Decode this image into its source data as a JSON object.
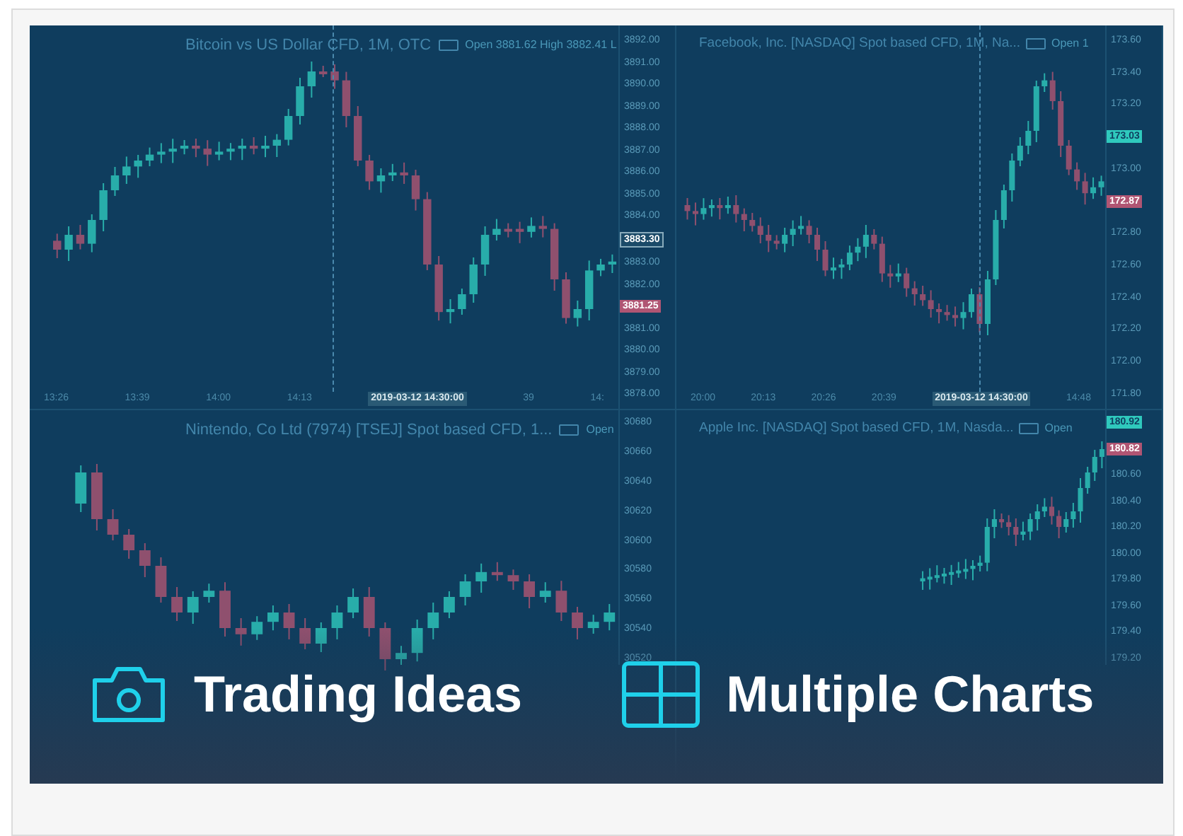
{
  "charts": [
    {
      "title": "Bitcoin vs US Dollar CFD, 1M, OTC",
      "legend": "Open 3881.62 High 3882.41 L",
      "axis": [
        "3892.00",
        "3891.00",
        "3890.00",
        "3889.00",
        "3888.00",
        "3887.00",
        "3886.00",
        "3885.00",
        "3884.00",
        "3883.00",
        "3882.00",
        "3881.00",
        "3880.00",
        "3879.00",
        "3878.00"
      ],
      "times": [
        {
          "label": "13:26"
        },
        {
          "label": "13:39"
        },
        {
          "label": "14:00"
        },
        {
          "label": "14:13"
        },
        {
          "label": "2019-03-12 14:30:00",
          "kind": "crosshair"
        },
        {
          "label": "39"
        },
        {
          "label": "14:"
        }
      ],
      "price_tags": [
        {
          "value": "3883.30",
          "kind": "crosshair"
        },
        {
          "value": "3881.25",
          "kind": "down"
        }
      ]
    },
    {
      "title": "Facebook, Inc. [NASDAQ] Spot based CFD, 1M, Na...",
      "legend": "Open 1",
      "axis": [
        "173.60",
        "173.40",
        "173.20",
        "173.00",
        "172.80",
        "172.60",
        "172.40",
        "172.20",
        "172.00",
        "171.80"
      ],
      "times": [
        {
          "label": "20:00"
        },
        {
          "label": "20:13"
        },
        {
          "label": "20:26"
        },
        {
          "label": "20:39"
        },
        {
          "label": "2019-03-12 14:30:00",
          "kind": "crosshair"
        },
        {
          "label": "14:48"
        }
      ],
      "price_tags": [
        {
          "value": "173.03",
          "kind": "up"
        },
        {
          "value": "172.87",
          "kind": "down"
        }
      ]
    },
    {
      "title": "Nintendo, Co Ltd (7974) [TSEJ] Spot based CFD, 1...",
      "legend": "Open",
      "axis": [
        "30680",
        "30660",
        "30640",
        "30620",
        "30600",
        "30580",
        "30560",
        "30540",
        "30520"
      ]
    },
    {
      "title": "Apple Inc. [NASDAQ] Spot based CFD, 1M, Nasda...",
      "legend": "Open",
      "axis": [
        "180.60",
        "180.40",
        "180.20",
        "180.00",
        "179.80",
        "179.60",
        "179.40",
        "179.20"
      ],
      "price_tags": [
        {
          "value": "180.92",
          "kind": "up"
        },
        {
          "value": "180.82",
          "kind": "down"
        }
      ]
    }
  ],
  "features": [
    {
      "kind": "camera",
      "label": "Trading Ideas"
    },
    {
      "kind": "grid",
      "label": "Multiple Charts"
    }
  ]
}
